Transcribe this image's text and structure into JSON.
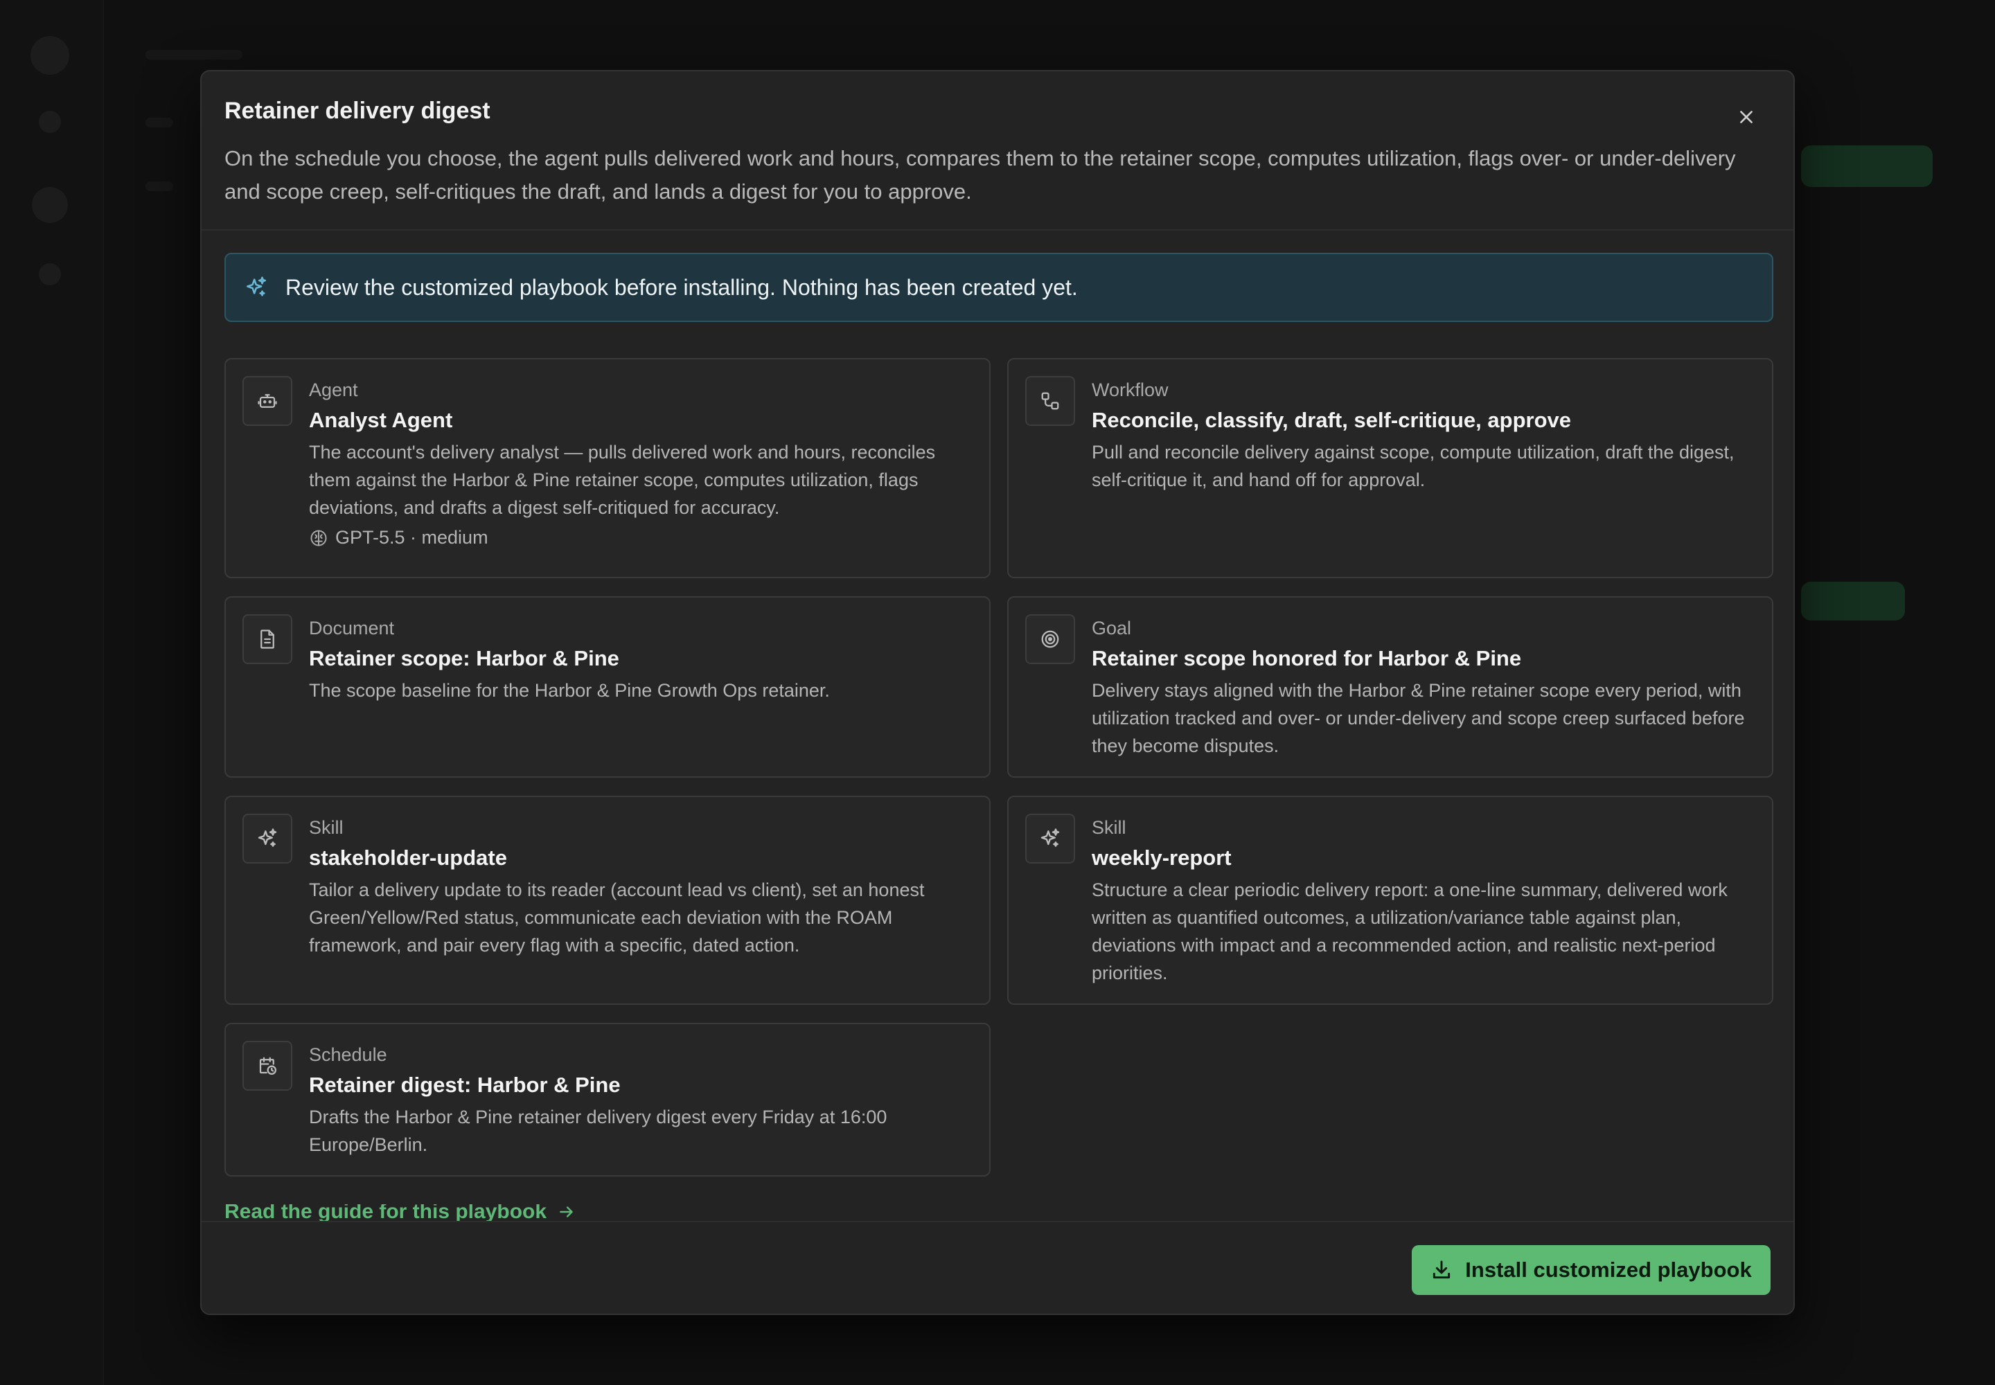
{
  "modal": {
    "title": "Retainer delivery digest",
    "description": "On the schedule you choose, the agent pulls delivered work and hours, compares them to the retainer scope, computes utilization, flags over- or under-delivery and scope creep, self-critiques the draft, and lands a digest for you to approve.",
    "close_icon": "close-icon"
  },
  "notice": {
    "icon": "sparkles-icon",
    "text": "Review the customized playbook before installing. Nothing has been created yet."
  },
  "cards": [
    {
      "icon": "robot-icon",
      "kind": "Agent",
      "title": "Analyst Agent",
      "description": "The account's delivery analyst — pulls delivered work and hours, reconciles them against the Harbor & Pine retainer scope, computes utilization, flags deviations, and drafts a digest self-critiqued for accuracy.",
      "meta_icon": "brain-icon",
      "meta": "GPT-5.5 · medium"
    },
    {
      "icon": "workflow-icon",
      "kind": "Workflow",
      "title": "Reconcile, classify, draft, self-critique, approve",
      "description": "Pull and reconcile delivery against scope, compute utilization, draft the digest, self-critique it, and hand off for approval."
    },
    {
      "icon": "document-icon",
      "kind": "Document",
      "title": "Retainer scope: Harbor & Pine",
      "description": "The scope baseline for the Harbor & Pine Growth Ops retainer."
    },
    {
      "icon": "target-icon",
      "kind": "Goal",
      "title": "Retainer scope honored for Harbor & Pine",
      "description": "Delivery stays aligned with the Harbor & Pine retainer scope every period, with utilization tracked and over- or under-delivery and scope creep surfaced before they become disputes."
    },
    {
      "icon": "sparkles-icon",
      "kind": "Skill",
      "title": "stakeholder-update",
      "description": "Tailor a delivery update to its reader (account lead vs client), set an honest Green/Yellow/Red status, communicate each deviation with the ROAM framework, and pair every flag with a specific, dated action."
    },
    {
      "icon": "sparkles-icon",
      "kind": "Skill",
      "title": "weekly-report",
      "description": "Structure a clear periodic delivery report: a one-line summary, delivered work written as quantified outcomes, a utilization/variance table against plan, deviations with impact and a recommended action, and realistic next-period priorities."
    },
    {
      "icon": "calendar-clock-icon",
      "kind": "Schedule",
      "title": "Retainer digest: Harbor & Pine",
      "description": "Drafts the Harbor & Pine retainer delivery digest every Friday at 16:00 Europe/Berlin."
    }
  ],
  "guide_link": {
    "label": "Read the guide for this playbook",
    "icon": "arrow-right-icon"
  },
  "footer": {
    "install_label": "Install customized playbook",
    "install_icon": "download-icon"
  },
  "colors": {
    "accent": "#5cba73",
    "modal_bg": "#232323",
    "notice_bg": "#1f3640"
  }
}
